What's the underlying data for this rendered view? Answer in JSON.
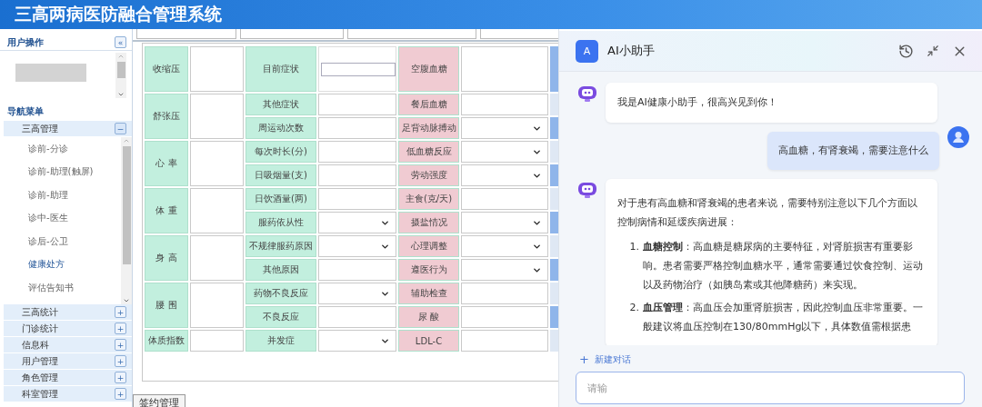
{
  "app": {
    "title": "三高两病医防融合管理系统"
  },
  "sidebar": {
    "user_section": {
      "title": "用户操作",
      "collapse_icon": "«"
    },
    "nav_title": "导航菜单",
    "groups": [
      {
        "label": "三高管理",
        "expanded": true,
        "toggle": "−",
        "children": [
          {
            "label": "诊前-分诊",
            "selected": false
          },
          {
            "label": "诊前-助理(触屏)",
            "selected": false
          },
          {
            "label": "诊前-助理",
            "selected": false
          },
          {
            "label": "诊中-医生",
            "selected": false
          },
          {
            "label": "诊后-公卫",
            "selected": false
          },
          {
            "label": "健康处方",
            "selected": true
          },
          {
            "label": "评估告知书",
            "selected": false
          }
        ]
      },
      {
        "label": "三高统计",
        "expanded": false,
        "toggle": "+"
      },
      {
        "label": "门诊统计",
        "expanded": false,
        "toggle": "+"
      },
      {
        "label": "信息科",
        "expanded": false,
        "toggle": "+"
      },
      {
        "label": "用户管理",
        "expanded": false,
        "toggle": "+"
      },
      {
        "label": "角色管理",
        "expanded": false,
        "toggle": "+"
      },
      {
        "label": "科室管理",
        "expanded": false,
        "toggle": "+"
      }
    ]
  },
  "form": {
    "left": [
      {
        "label": "收缩压"
      },
      {
        "label": "舒张压"
      },
      {
        "label": "心 率"
      },
      {
        "label": "体 重"
      },
      {
        "label": "身 高"
      },
      {
        "label": "腰 围"
      },
      {
        "label": "体质指数"
      }
    ],
    "middle": [
      {
        "label": "目前症状",
        "kind": "box"
      },
      {
        "label": "其他症状",
        "kind": "text"
      },
      {
        "label": "周运动次数",
        "kind": "text"
      },
      {
        "label": "每次时长(分)",
        "kind": "text"
      },
      {
        "label": "日吸烟量(支)",
        "kind": "text"
      },
      {
        "label": "日饮酒量(两)",
        "kind": "text"
      },
      {
        "label": "服药依从性",
        "kind": "select"
      },
      {
        "label": "不规律服药原因",
        "kind": "select"
      },
      {
        "label": "其他原因",
        "kind": "text"
      },
      {
        "label": "药物不良反应",
        "kind": "select"
      },
      {
        "label": "不良反应",
        "kind": "text"
      },
      {
        "label": "并发症",
        "kind": "select"
      }
    ],
    "right": [
      {
        "label": "空腹血糖",
        "kind": "text"
      },
      {
        "label": "餐后血糖",
        "kind": "text"
      },
      {
        "label": "足背动脉搏动",
        "kind": "select"
      },
      {
        "label": "低血糖反应",
        "kind": "select"
      },
      {
        "label": "劳动强度",
        "kind": "select"
      },
      {
        "label": "主食(克/天)",
        "kind": "text"
      },
      {
        "label": "摄盐情况",
        "kind": "select"
      },
      {
        "label": "心理调整",
        "kind": "select"
      },
      {
        "label": "遵医行为",
        "kind": "select"
      },
      {
        "label": "辅助检查",
        "kind": "text"
      },
      {
        "label": "尿 酸",
        "kind": "text"
      },
      {
        "label": "LDL-C",
        "kind": "text"
      }
    ]
  },
  "bottom_tab": {
    "label": "签约管理"
  },
  "assistant": {
    "avatar_letter": "A",
    "title": "AI小助手",
    "messages": [
      {
        "kind": "bot",
        "text": "我是AI健康小助手，很高兴见到你！"
      },
      {
        "kind": "user",
        "text": "高血糖，有肾衰竭，需要注意什么"
      },
      {
        "kind": "bot",
        "text": "对于患有高血糖和肾衰竭的患者来说，需要特别注意以下几个方面以控制病情和延缓疾病进展：",
        "list": [
          {
            "marker": "1.",
            "text": "**血糖控制**：高血糖是糖尿病的主要特征，对肾脏损害有重要影响。患者需要严格控制血糖水平，通常需要通过饮食控制、运动以及药物治疗（如胰岛素或其他降糖药）来实现。"
          },
          {
            "marker": "2.",
            "text": "**血压管理**：高血压会加重肾脏损害，因此控制血压非常重要。一般建议将血压控制在130/80mmHg以下，具体数值需根据患"
          }
        ]
      }
    ],
    "new_chat": {
      "icon": "+",
      "label": "新建对话"
    },
    "input": {
      "placeholder": "请输"
    }
  }
}
